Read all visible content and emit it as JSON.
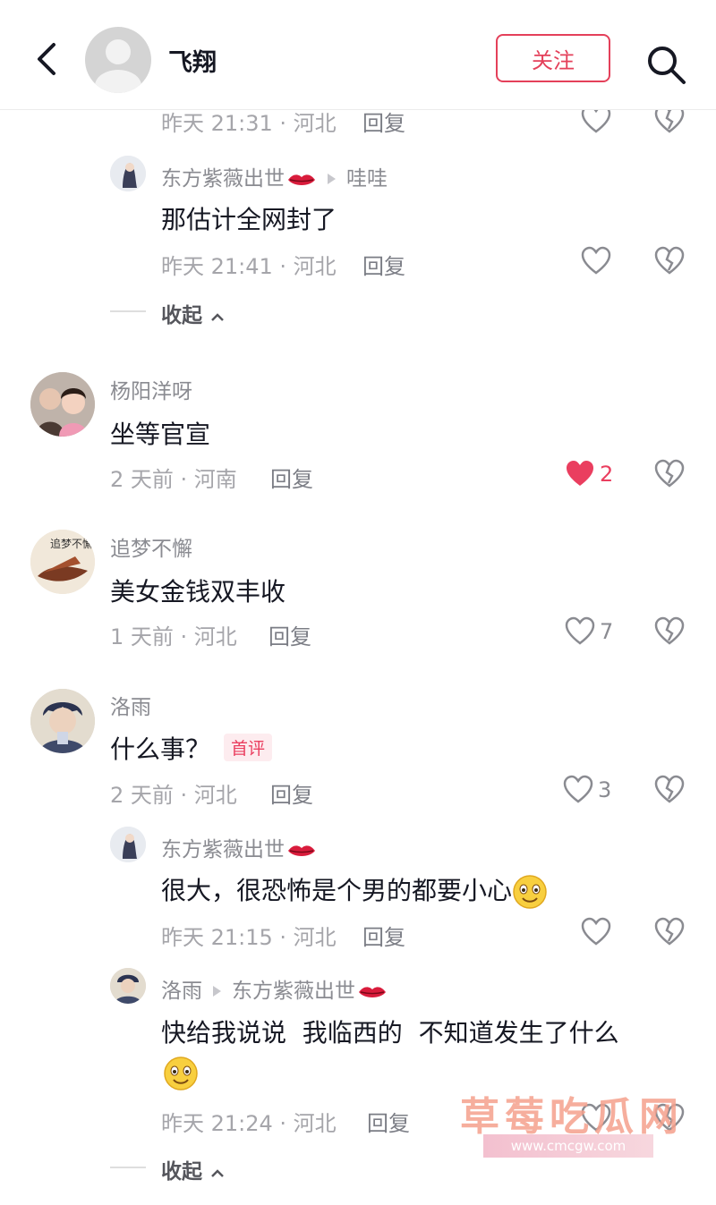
{
  "header": {
    "name": "飞翔",
    "follow_label": "关注"
  },
  "colors": {
    "accent": "#e4405a",
    "like_red": "#ea3e5f",
    "meta_gray": "#a5a5aa"
  },
  "thread_top": {
    "partial_meta": "昨天 21:31 · 河北",
    "reply_label": "回复",
    "reply1": {
      "name": "东方紫薇出世",
      "to": "哇哇",
      "text": "那估计全网封了",
      "meta": "昨天 21:41 · 河北",
      "reply_label": "回复"
    },
    "collapse_label": "收起"
  },
  "comments": [
    {
      "name": "杨阳洋呀",
      "text": "坐等官宣",
      "meta": "2 天前 · 河南",
      "reply_label": "回复",
      "likes": "2"
    },
    {
      "name": "追梦不懈",
      "text": "美女金钱双丰收",
      "meta": "1 天前 · 河北",
      "reply_label": "回复",
      "likes": "7",
      "avatar_text": "追梦不懈"
    },
    {
      "name": "洛雨",
      "text": "什么事？",
      "badge": "首评",
      "meta": "2 天前 · 河北",
      "reply_label": "回复",
      "likes": "3"
    }
  ],
  "replies": [
    {
      "name": "东方紫薇出世",
      "text": "很大，很恐怖是个男的都要小心",
      "meta": "昨天 21:15 · 河北",
      "reply_label": "回复"
    },
    {
      "name": "洛雨",
      "to": "东方紫薇出世",
      "text": "快给我说说  我临西的  不知道发生了什么",
      "meta": "昨天 21:24 · 河北",
      "reply_label": "回复"
    }
  ],
  "collapse_bottom": "收起",
  "watermark": {
    "text": "草莓吃瓜网",
    "url": "www.cmcgw.com"
  },
  "icons": [
    "chevron-left-icon",
    "search-icon",
    "heart-icon",
    "heart-filled-icon",
    "broken-heart-icon",
    "lips-emoji-icon",
    "smile-emoji-icon",
    "play-triangle-icon",
    "chevron-up-icon"
  ]
}
